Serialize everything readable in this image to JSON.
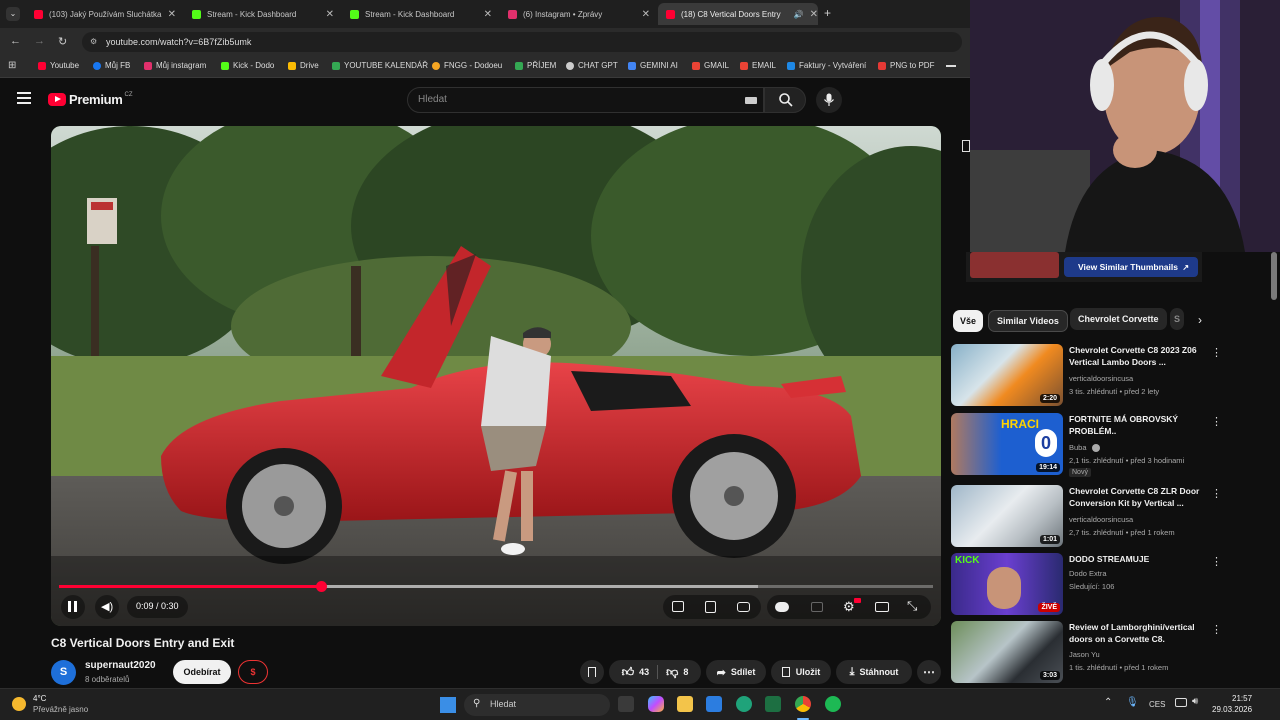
{
  "browser": {
    "tabs": [
      {
        "title": "(103) Jaký Používám Sluchátka",
        "active": false,
        "color": "#ff0033"
      },
      {
        "title": "Stream - Kick Dashboard",
        "active": false,
        "color": "#53fc18"
      },
      {
        "title": "Stream - Kick Dashboard",
        "active": false,
        "color": "#53fc18"
      },
      {
        "title": "(6) Instagram • Zprávy",
        "active": false,
        "color": "#e1306c"
      },
      {
        "title": "(18) C8 Vertical Doors Entry",
        "active": true,
        "color": "#ff0033"
      }
    ],
    "url": "youtube.com/watch?v=6B7fZib5umk",
    "bookmarks": [
      {
        "label": "Youtube",
        "color": "#ff0033"
      },
      {
        "label": "Můj FB",
        "color": "#1877f2"
      },
      {
        "label": "Můj instagram",
        "color": "#e1306c"
      },
      {
        "label": "Kick - Dodo",
        "color": "#53fc18"
      },
      {
        "label": "Drive",
        "color": "#fbbc04"
      },
      {
        "label": "YOUTUBE KALENDÁŘ",
        "color": "#34a853"
      },
      {
        "label": "FNGG - Dodoeu",
        "color": "#f5a623"
      },
      {
        "label": "PŘÍJEM",
        "color": "#34a853"
      },
      {
        "label": "CHAT GPT",
        "color": "#cccccc"
      },
      {
        "label": "GEMINI AI",
        "color": "#4285f4"
      },
      {
        "label": "GMAIL",
        "color": "#ea4335"
      },
      {
        "label": "EMAIL",
        "color": "#ea4335"
      },
      {
        "label": "Faktury - Vytváření",
        "color": "#1e88e5"
      },
      {
        "label": "PNG to PDF",
        "color": "#e53935"
      }
    ]
  },
  "youtube": {
    "logo": "Premium",
    "region": "CZ",
    "search_placeholder": "Hledat",
    "player": {
      "time": "0:09 / 0:30",
      "progress": 0.3
    },
    "video_title": "C8 Vertical Doors Entry and Exit",
    "channel": {
      "avatar_letter": "S",
      "name": "supernaut2020",
      "subs": "8 odběratelů",
      "subscribe": "Odebírat",
      "join": "$"
    },
    "actions": {
      "likes": "43",
      "dislikes": "8",
      "share": "Sdílet",
      "save": "Uložit",
      "download": "Stáhnout"
    },
    "view_similar": "View Similar Thumbnails",
    "chips": [
      "Vše",
      "Similar Videos",
      "Chevrolet Corvette",
      "S"
    ],
    "recommendations": [
      {
        "title": "Chevrolet Corvette C8 2023 Z06 Vertical Lambo Doors ...",
        "channel": "verticaldoorsincusa",
        "meta": "3 tis. zhlédnutí • před 2 lety",
        "duration": "2:20"
      },
      {
        "title": "FORTNITE MÁ OBROVSKÝ PROBLÉM..",
        "channel": "Buba",
        "meta": "2,1 tis. zhlédnutí • před 3 hodinami",
        "badge": "Nový",
        "duration": "19:14",
        "thumb_text": "HRACI",
        "thumb_num": "0"
      },
      {
        "title": "Chevrolet Corvette C8 ZLR Door Conversion Kit by Vertical ...",
        "channel": "verticaldoorsincusa",
        "meta": "2,7 tis. zhlédnutí • před 1 rokem",
        "duration": "1:01"
      },
      {
        "title": "DODO STREAMUJE",
        "channel": "Dodo Extra",
        "meta": "Sledující: 106",
        "duration": "ŽIVĚ",
        "thumb_text": "KICK"
      },
      {
        "title": "Review of Lamborghini/vertical doors on a Corvette C8.",
        "channel": "Jason Yu",
        "meta": "1 tis. zhlédnutí • před 1 rokem",
        "duration": "3:03"
      }
    ]
  },
  "taskbar": {
    "weather_temp": "4°C",
    "weather_desc": "Převážně jasno",
    "search": "Hledat",
    "lang": "CES",
    "time": "21:57",
    "date": "29.03.2026"
  }
}
